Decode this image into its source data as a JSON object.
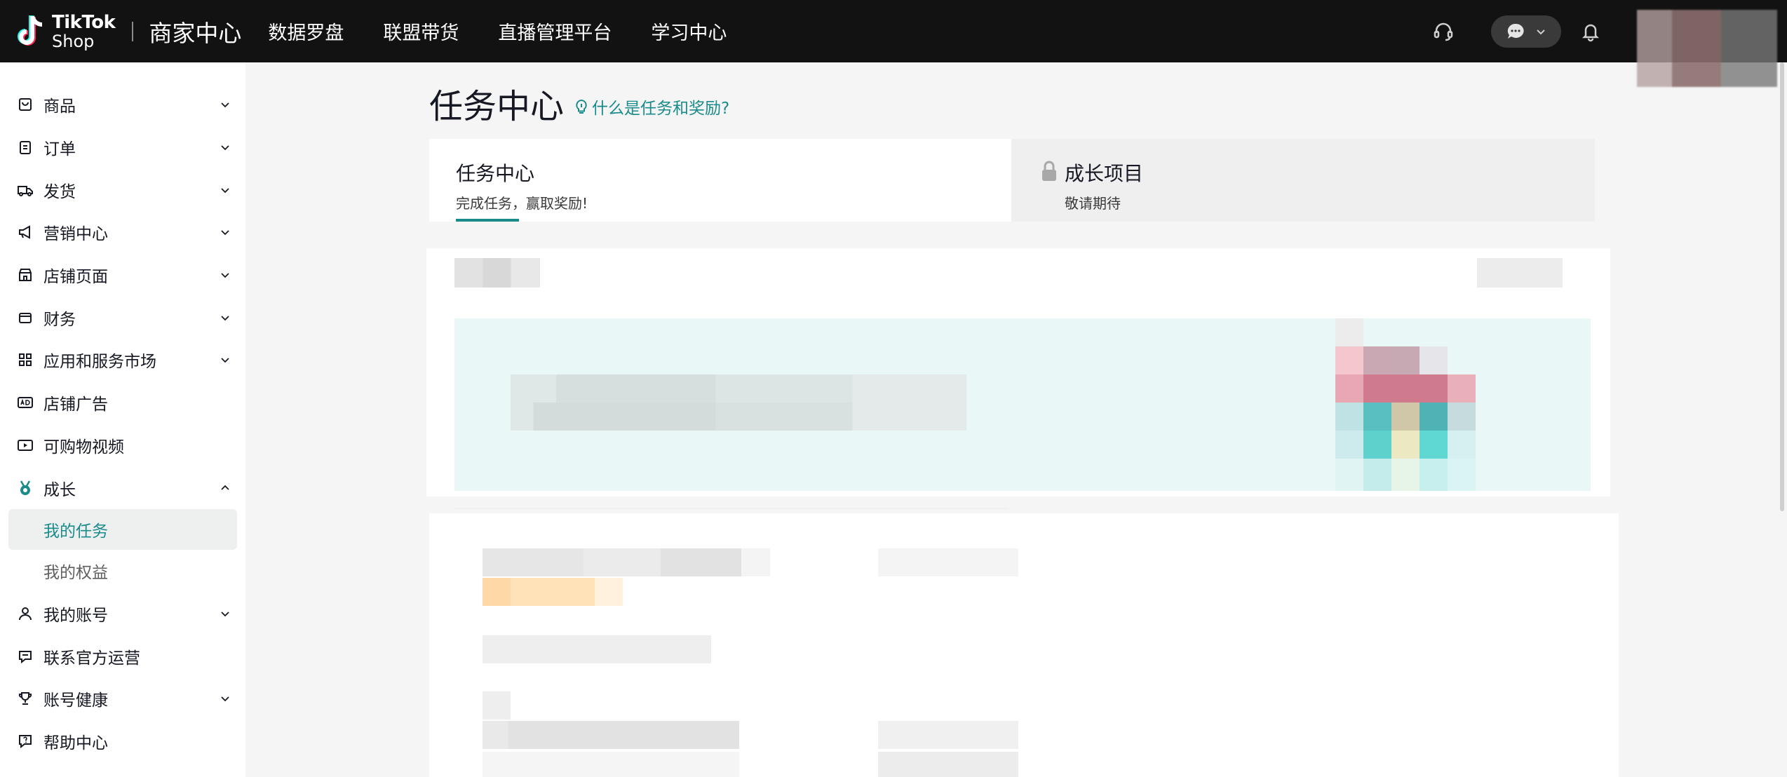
{
  "header": {
    "logo_line1": "TikTok",
    "logo_line2": "Shop",
    "brand_title": "商家中心",
    "nav": [
      "数据罗盘",
      "联盟带货",
      "直播管理平台",
      "学习中心"
    ]
  },
  "sidebar": {
    "items": [
      {
        "label": "商品",
        "icon": "product-icon",
        "chevron": "down"
      },
      {
        "label": "订单",
        "icon": "order-icon",
        "chevron": "down"
      },
      {
        "label": "发货",
        "icon": "shipping-icon",
        "chevron": "down"
      },
      {
        "label": "营销中心",
        "icon": "megaphone-icon",
        "chevron": "down"
      },
      {
        "label": "店铺页面",
        "icon": "store-icon",
        "chevron": "down"
      },
      {
        "label": "财务",
        "icon": "wallet-icon",
        "chevron": "down"
      },
      {
        "label": "应用和服务市场",
        "icon": "apps-icon",
        "chevron": "down"
      },
      {
        "label": "店铺广告",
        "icon": "ad-icon",
        "chevron": ""
      },
      {
        "label": "可购物视频",
        "icon": "video-icon",
        "chevron": ""
      },
      {
        "label": "成长",
        "icon": "medal-icon",
        "chevron": "up"
      }
    ],
    "growth_sub": [
      "我的任务",
      "我的权益"
    ],
    "items_after": [
      {
        "label": "我的账号",
        "icon": "user-icon",
        "chevron": "down"
      },
      {
        "label": "联系官方运营",
        "icon": "contact-icon",
        "chevron": ""
      },
      {
        "label": "账号健康",
        "icon": "trophy-icon",
        "chevron": "down"
      },
      {
        "label": "帮助中心",
        "icon": "help-icon",
        "chevron": ""
      }
    ]
  },
  "main": {
    "title": "任务中心",
    "help_link": "什么是任务和奖励?",
    "tabs": [
      {
        "title": "任务中心",
        "subtitle": "完成任务，赢取奖励!"
      },
      {
        "title": "成长项目",
        "subtitle": "敬请期待"
      }
    ]
  },
  "colors": {
    "accent": "#1a8b8b",
    "topbar": "#121212"
  }
}
